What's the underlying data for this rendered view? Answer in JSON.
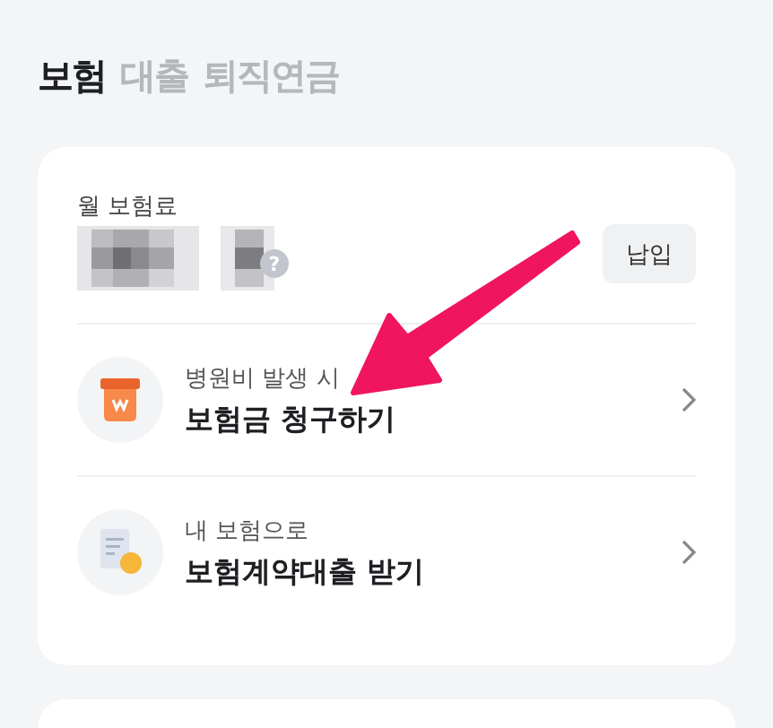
{
  "tabs": [
    {
      "label": "보험",
      "selected": true
    },
    {
      "label": "대출",
      "selected": false
    },
    {
      "label": "퇴직연금",
      "selected": false
    }
  ],
  "premium": {
    "label": "월 보험료",
    "help": "?",
    "button": "납입"
  },
  "actions": [
    {
      "kind": "claim",
      "subtitle": "병원비 발생 시",
      "title": "보험금 청구하기"
    },
    {
      "kind": "loan",
      "subtitle": "내 보험으로",
      "title": "보험계약대출 받기"
    }
  ]
}
